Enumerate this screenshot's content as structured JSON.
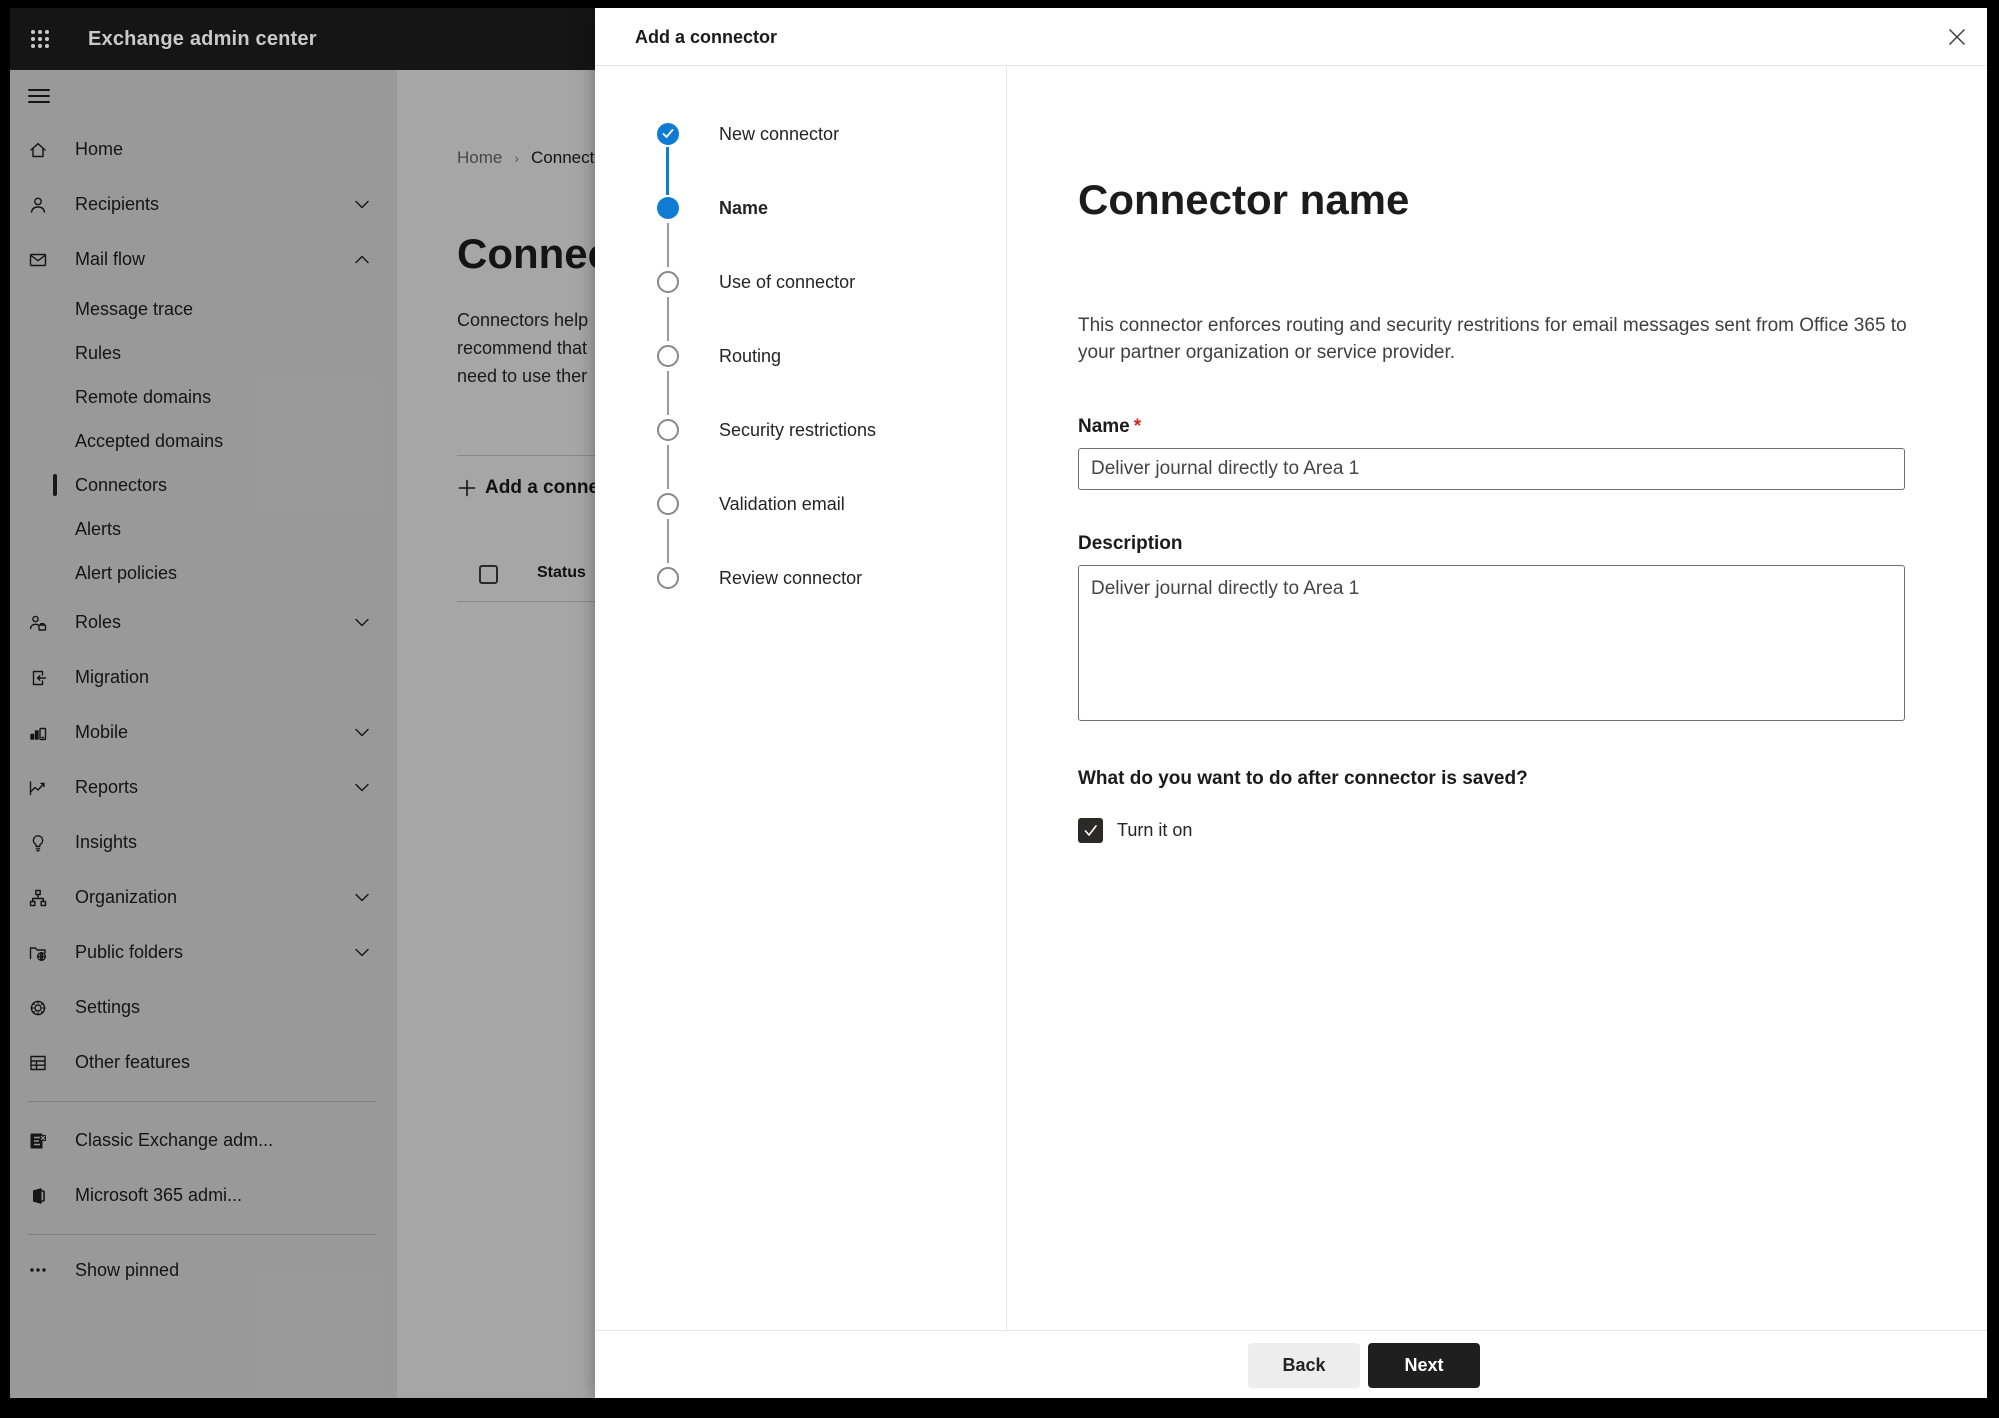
{
  "topbar": {
    "title": "Exchange admin center"
  },
  "sidebar": {
    "items_top": [
      {
        "label": "Home"
      },
      {
        "label": "Recipients",
        "chevron": "down"
      },
      {
        "label": "Mail flow",
        "chevron": "up"
      }
    ],
    "mailflow_children": [
      {
        "label": "Message trace",
        "selected": false
      },
      {
        "label": "Rules",
        "selected": false
      },
      {
        "label": "Remote domains",
        "selected": false
      },
      {
        "label": "Accepted domains",
        "selected": false
      },
      {
        "label": "Connectors",
        "selected": true
      },
      {
        "label": "Alerts",
        "selected": false
      },
      {
        "label": "Alert policies",
        "selected": false
      }
    ],
    "items_mid": [
      {
        "label": "Roles",
        "chevron": "down"
      },
      {
        "label": "Migration"
      },
      {
        "label": "Mobile",
        "chevron": "down"
      },
      {
        "label": "Reports",
        "chevron": "down"
      },
      {
        "label": "Insights"
      },
      {
        "label": "Organization",
        "chevron": "down"
      },
      {
        "label": "Public folders",
        "chevron": "down"
      },
      {
        "label": "Settings"
      },
      {
        "label": "Other features"
      }
    ],
    "items_bottom": [
      {
        "label": "Classic Exchange adm..."
      },
      {
        "label": "Microsoft 365 admi..."
      }
    ],
    "show_pinned": "Show pinned"
  },
  "page": {
    "breadcrumb": {
      "home": "Home",
      "current": "Connectors"
    },
    "title": "Connectors",
    "intro_lines": [
      "Connectors help",
      "recommend that",
      "need to use ther"
    ],
    "add_button": "Add a connector",
    "table": {
      "status_header": "Status"
    }
  },
  "dialog": {
    "title": "Add a connector",
    "steps": [
      {
        "label": "New connector",
        "state": "completed"
      },
      {
        "label": "Name",
        "state": "current"
      },
      {
        "label": "Use of connector",
        "state": "upcoming"
      },
      {
        "label": "Routing",
        "state": "upcoming"
      },
      {
        "label": "Security restrictions",
        "state": "upcoming"
      },
      {
        "label": "Validation email",
        "state": "upcoming"
      },
      {
        "label": "Review connector",
        "state": "upcoming"
      }
    ],
    "content": {
      "heading": "Connector name",
      "description": "This connector enforces routing and security restritions for email messages sent from Office 365 to your partner organization or service provider.",
      "name_label": "Name",
      "required_mark": "*",
      "name_value": "Deliver journal directly to Area 1",
      "description_label": "Description",
      "description_value": "Deliver journal directly to Area 1",
      "after_save_question": "What do you want to do after connector is saved?",
      "turn_on_label": "Turn it on",
      "turn_on_checked": true
    },
    "footer": {
      "back": "Back",
      "next": "Next"
    }
  },
  "colors": {
    "accent_blue": "#0f7bd3",
    "next_button_bg": "#1f1f1f",
    "back_button_bg": "#ededed",
    "required_red": "#c42b1c",
    "checkbox_bg": "#2b2a29",
    "topbar_bg": "#151515"
  }
}
